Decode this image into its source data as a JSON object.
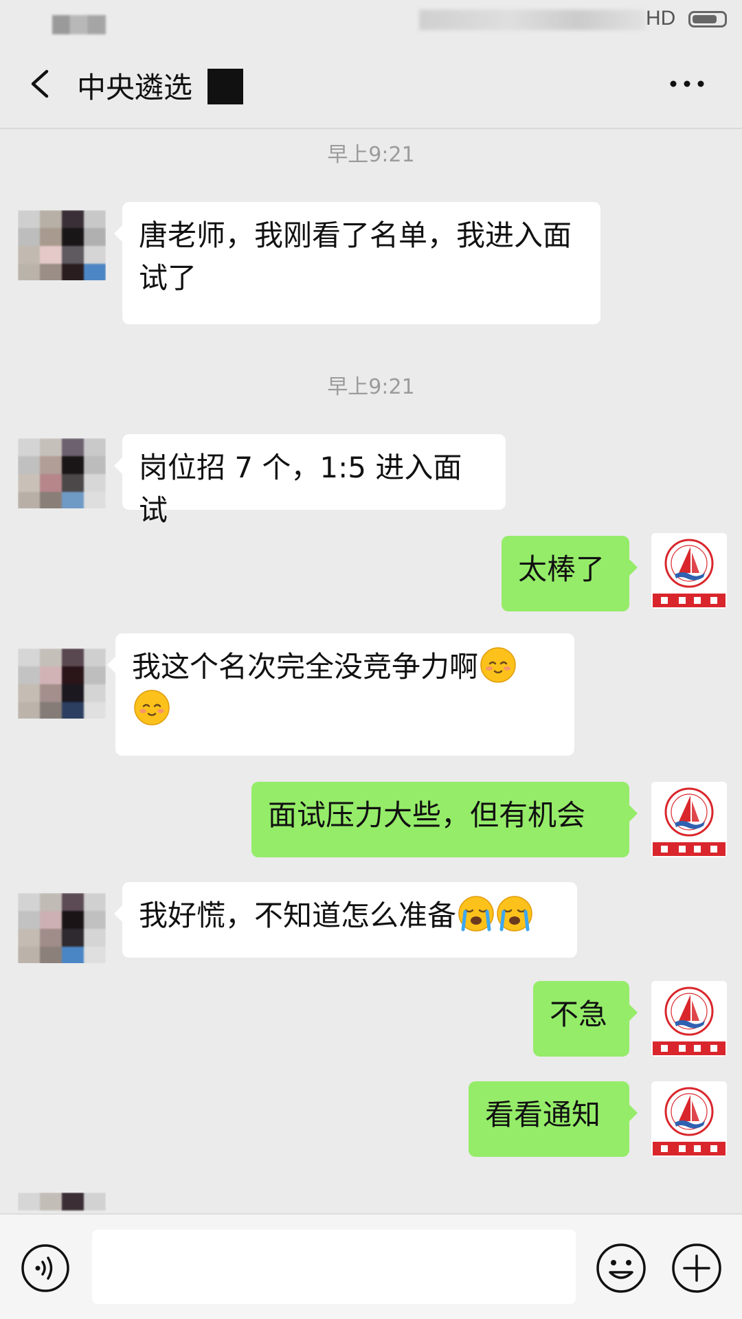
{
  "status_bar": {
    "network_label": "HD",
    "icons": [
      "signal-icon",
      "wifi-icon",
      "battery-icon"
    ],
    "battery_level": 0.8
  },
  "header": {
    "title": "中央遴选",
    "back_icon": "chevron-left-icon",
    "more_icon": "more-dots-icon"
  },
  "messages": [
    {
      "type": "timestamp",
      "text": "早上9:21"
    },
    {
      "type": "message",
      "side": "left",
      "line1": "唐老师，我刚看了名单，我进入面",
      "line2": "试了"
    },
    {
      "type": "timestamp",
      "text": "早上9:21"
    },
    {
      "type": "message",
      "side": "left",
      "text": "岗位招 7 个，1:5 进入面试"
    },
    {
      "type": "message",
      "side": "right",
      "text": "太棒了"
    },
    {
      "type": "message",
      "side": "left",
      "text": "我这个名次完全没竞争力啊",
      "emoji": "smiling-face-icon"
    },
    {
      "type": "message",
      "side": "right",
      "text": "面试压力大些，但有机会"
    },
    {
      "type": "message",
      "side": "left",
      "text": "我好慌，不知道怎么准备",
      "emoji": "loudly-crying-face-icon"
    },
    {
      "type": "message",
      "side": "right",
      "text": "不急"
    },
    {
      "type": "message",
      "side": "right",
      "text": "看看通知"
    }
  ],
  "colors": {
    "background": "#ebebeb",
    "sent_bubble": "#95ec69",
    "received_bubble": "#ffffff",
    "timestamp_text": "#9b9b9b",
    "logo_red": "#d9262c",
    "logo_blue": "#2e61b0"
  },
  "input_bar": {
    "voice_icon": "voice-input-icon",
    "placeholder": "",
    "emoji_icon": "emoji-smile-icon",
    "plus_icon": "plus-circle-icon"
  }
}
